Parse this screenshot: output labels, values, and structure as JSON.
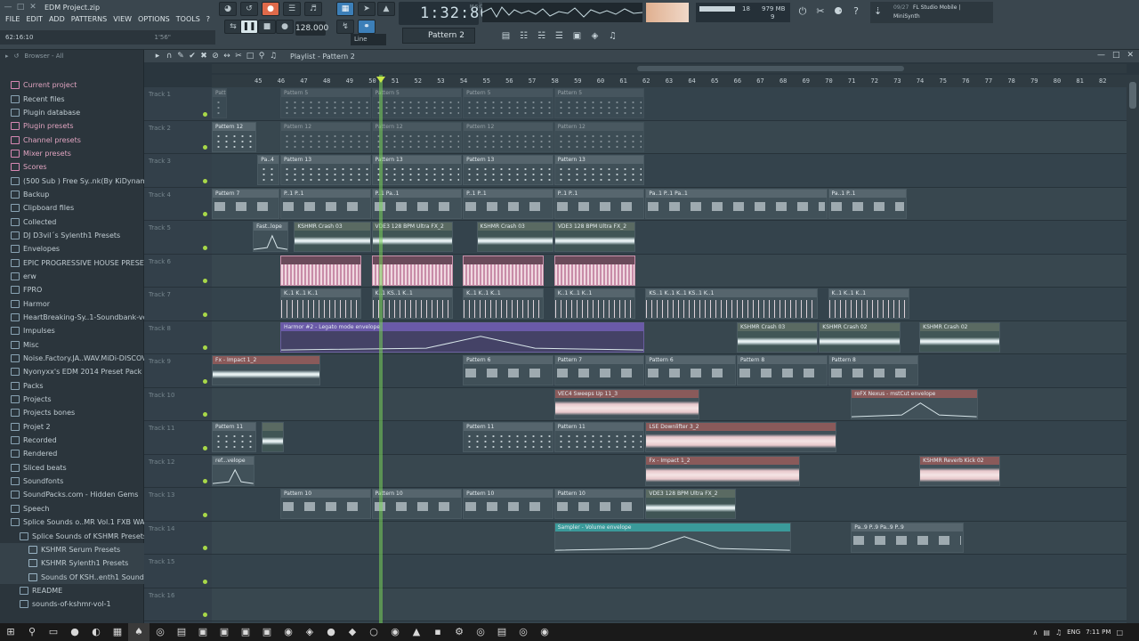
{
  "window": {
    "project_title": "EDM Project.zip"
  },
  "menu": [
    "FILE",
    "EDIT",
    "ADD",
    "PATTERNS",
    "VIEW",
    "OPTIONS",
    "TOOLS",
    "?"
  ],
  "hint": {
    "time": "62:16:10",
    "extra": "1'56\""
  },
  "transport": {
    "tempo": "128.000",
    "song_time": "1:32:86",
    "time_unit": "M:S:CS",
    "pattern": "Pattern 2",
    "snap": "Line"
  },
  "memory": {
    "cpu": "18",
    "ram": "979 MB",
    "poly": "9"
  },
  "news": {
    "date": "09/27",
    "title": "FL Studio Mobile |",
    "subtitle": "MiniSynth"
  },
  "browser": {
    "label": "Browser - All",
    "items": [
      {
        "label": "Current project",
        "style": "pink"
      },
      {
        "label": "Recent files",
        "style": "normal"
      },
      {
        "label": "Plugin database",
        "style": "normal"
      },
      {
        "label": "Plugin presets",
        "style": "pink"
      },
      {
        "label": "Channel presets",
        "style": "pink"
      },
      {
        "label": "Mixer presets",
        "style": "pink"
      },
      {
        "label": "Scores",
        "style": "pink"
      },
      {
        "label": "(500 Sub ) Free Sy..nk(By KiDynamic)",
        "style": "normal"
      },
      {
        "label": "Backup",
        "style": "normal"
      },
      {
        "label": "Clipboard files",
        "style": "normal"
      },
      {
        "label": "Collected",
        "style": "normal"
      },
      {
        "label": "DJ D3vil´s Sylenth1 Presets",
        "style": "normal"
      },
      {
        "label": "Envelopes",
        "style": "normal"
      },
      {
        "label": "EPIC PROGRESSIVE HOUSE PRESETS",
        "style": "normal"
      },
      {
        "label": "erw",
        "style": "normal"
      },
      {
        "label": "FPRO",
        "style": "normal"
      },
      {
        "label": "Harmor",
        "style": "normal"
      },
      {
        "label": "HeartBreaking-Sy..1-Soundbank-vol3",
        "style": "normal"
      },
      {
        "label": "Impulses",
        "style": "normal"
      },
      {
        "label": "Misc",
        "style": "normal"
      },
      {
        "label": "Noise.Factory.JA..WAV.MiDi-DISCOVER",
        "style": "normal"
      },
      {
        "label": "Nyonyxx's EDM 2014 Preset Pack",
        "style": "normal"
      },
      {
        "label": "Packs",
        "style": "normal"
      },
      {
        "label": "Projects",
        "style": "normal"
      },
      {
        "label": "Projects bones",
        "style": "normal"
      },
      {
        "label": "Projet 2",
        "style": "normal"
      },
      {
        "label": "Recorded",
        "style": "normal"
      },
      {
        "label": "Rendered",
        "style": "normal"
      },
      {
        "label": "Sliced beats",
        "style": "normal"
      },
      {
        "label": "Soundfonts",
        "style": "normal"
      },
      {
        "label": "SoundPacks.com - Hidden Gems",
        "style": "normal"
      },
      {
        "label": "Speech",
        "style": "normal"
      },
      {
        "label": "Splice Sounds o..MR Vol.1 FXB WAV",
        "style": "normal"
      },
      {
        "label": "Splice Sounds of KSHMR Presets",
        "style": "lvl2"
      },
      {
        "label": "KSHMR Serum Presets",
        "style": "lvl3"
      },
      {
        "label": "KSHMR Sylenth1 Presets",
        "style": "lvl3"
      },
      {
        "label": "Sounds Of KSH..enth1 Soundset",
        "style": "lvl3"
      },
      {
        "label": "README",
        "style": "lvl2"
      },
      {
        "label": "sounds-of-kshmr-vol-1",
        "style": "lvl2"
      }
    ]
  },
  "playlist": {
    "title": "Playlist - Pattern 2",
    "ruler": [
      "45",
      "46",
      "47",
      "48",
      "49",
      "50",
      "51",
      "52",
      "53",
      "54",
      "55",
      "56",
      "57",
      "58",
      "59",
      "60",
      "61",
      "62",
      "63",
      "64",
      "65",
      "66",
      "67",
      "68",
      "69",
      "70",
      "71",
      "72",
      "73",
      "74",
      "75",
      "76",
      "77",
      "78",
      "79",
      "80",
      "81",
      "82"
    ],
    "tracks": [
      "Track 1",
      "Track 2",
      "Track 3",
      "Track 4",
      "Track 5",
      "Track 6",
      "Track 7",
      "Track 8",
      "Track 9",
      "Track 10",
      "Track 11",
      "Track 12",
      "Track 13",
      "Track 14",
      "Track 15",
      "Track 16"
    ],
    "clips": [
      {
        "track": 0,
        "start": 0.0,
        "len": 0.7,
        "label": "Pattern 4",
        "kind": "notes",
        "dim": true
      },
      {
        "track": 0,
        "start": 3.0,
        "len": 4.0,
        "label": "Pattern 5",
        "kind": "notes",
        "dim": true
      },
      {
        "track": 0,
        "start": 7.0,
        "len": 4.0,
        "label": "Pattern 5",
        "kind": "notes",
        "dim": true
      },
      {
        "track": 0,
        "start": 11.0,
        "len": 4.0,
        "label": "Pattern 5",
        "kind": "notes",
        "dim": true
      },
      {
        "track": 0,
        "start": 15.0,
        "len": 4.0,
        "label": "Pattern 5",
        "kind": "notes",
        "dim": true
      },
      {
        "track": 1,
        "start": 0.0,
        "len": 2.0,
        "label": "Pattern 12",
        "kind": "notes"
      },
      {
        "track": 1,
        "start": 3.0,
        "len": 4.0,
        "label": "Pattern 12",
        "kind": "notes",
        "dim": true
      },
      {
        "track": 1,
        "start": 7.0,
        "len": 4.0,
        "label": "Pattern 12",
        "kind": "notes",
        "dim": true
      },
      {
        "track": 1,
        "start": 11.0,
        "len": 4.0,
        "label": "Pattern 12",
        "kind": "notes",
        "dim": true
      },
      {
        "track": 1,
        "start": 15.0,
        "len": 4.0,
        "label": "Pattern 12",
        "kind": "notes",
        "dim": true
      },
      {
        "track": 2,
        "start": 2.0,
        "len": 1.0,
        "label": "Pa..4",
        "kind": "notes"
      },
      {
        "track": 2,
        "start": 3.0,
        "len": 4.0,
        "label": "Pattern 13",
        "kind": "notes"
      },
      {
        "track": 2,
        "start": 7.0,
        "len": 4.0,
        "label": "Pattern 13",
        "kind": "notes"
      },
      {
        "track": 2,
        "start": 11.0,
        "len": 4.0,
        "label": "Pattern 13",
        "kind": "notes"
      },
      {
        "track": 2,
        "start": 15.0,
        "len": 4.0,
        "label": "Pattern 13",
        "kind": "notes"
      },
      {
        "track": 3,
        "start": 0.0,
        "len": 3.0,
        "label": "Pattern 7",
        "kind": "bars"
      },
      {
        "track": 3,
        "start": 3.0,
        "len": 4.0,
        "label": "P..1 P..1",
        "kind": "bars"
      },
      {
        "track": 3,
        "start": 7.0,
        "len": 4.0,
        "label": "P..1 Pa..1",
        "kind": "bars"
      },
      {
        "track": 3,
        "start": 11.0,
        "len": 4.0,
        "label": "P..1 P..1",
        "kind": "bars"
      },
      {
        "track": 3,
        "start": 15.0,
        "len": 4.0,
        "label": "P..1 P..1",
        "kind": "bars"
      },
      {
        "track": 3,
        "start": 19.0,
        "len": 8.0,
        "label": "Pa..1 P..1 Pa..1",
        "kind": "bars"
      },
      {
        "track": 3,
        "start": 27.0,
        "len": 3.5,
        "label": "Pa..1 P..1",
        "kind": "bars"
      },
      {
        "track": 4,
        "start": 1.8,
        "len": 1.6,
        "label": "Fast..lope",
        "kind": "env",
        "color": "pinkhead"
      },
      {
        "track": 4,
        "start": 3.6,
        "len": 3.4,
        "label": "KSHMR Crash 03",
        "kind": "wave",
        "color": "crash"
      },
      {
        "track": 4,
        "start": 7.0,
        "len": 3.6,
        "label": "VDE3 128 BPM Ultra FX_2",
        "kind": "wave",
        "color": "crash"
      },
      {
        "track": 4,
        "start": 11.6,
        "len": 3.4,
        "label": "KSHMR Crash 03",
        "kind": "wave",
        "color": "crash"
      },
      {
        "track": 4,
        "start": 15.0,
        "len": 3.6,
        "label": "VDE3 128 BPM Ultra FX_2",
        "kind": "wave",
        "color": "crash"
      },
      {
        "track": 5,
        "start": 3.0,
        "len": 3.6,
        "label": "pink",
        "kind": "pinkwave"
      },
      {
        "track": 5,
        "start": 7.0,
        "len": 3.6,
        "label": "pink",
        "kind": "pinkwave"
      },
      {
        "track": 5,
        "start": 11.0,
        "len": 3.6,
        "label": "pink",
        "kind": "pinkwave"
      },
      {
        "track": 5,
        "start": 15.0,
        "len": 3.6,
        "label": "pink",
        "kind": "pinkwave"
      },
      {
        "track": 6,
        "start": 3.0,
        "len": 3.6,
        "label": "K..1 K..1 K..1",
        "kind": "spikes"
      },
      {
        "track": 6,
        "start": 7.0,
        "len": 3.6,
        "label": "K..1 KS..1 K..1",
        "kind": "spikes"
      },
      {
        "track": 6,
        "start": 11.0,
        "len": 3.6,
        "label": "K..1 K..1 K..1",
        "kind": "spikes"
      },
      {
        "track": 6,
        "start": 15.0,
        "len": 3.6,
        "label": "K..1 K..1 K..1",
        "kind": "spikes"
      },
      {
        "track": 6,
        "start": 19.0,
        "len": 7.6,
        "label": "KS..1 K..1 K..1 KS..1 K..1",
        "kind": "spikes"
      },
      {
        "track": 6,
        "start": 27.0,
        "len": 3.6,
        "label": "K..1 K..1 K..1",
        "kind": "spikes"
      },
      {
        "track": 7,
        "start": 3.0,
        "len": 16.0,
        "label": "Harmor #2 - Legato mode envelope",
        "kind": "env",
        "color": "purple"
      },
      {
        "track": 7,
        "start": 23.0,
        "len": 3.6,
        "label": "KSHMR Crash 03",
        "kind": "wave",
        "color": "crash"
      },
      {
        "track": 7,
        "start": 26.6,
        "len": 3.6,
        "label": "KSHMR Crash 02",
        "kind": "wave",
        "color": "crash"
      },
      {
        "track": 7,
        "start": 31.0,
        "len": 3.6,
        "label": "KSHMR Crash 02",
        "kind": "wave",
        "color": "crash"
      },
      {
        "track": 8,
        "start": 0.0,
        "len": 4.8,
        "label": "Fx - Impact 1_2",
        "kind": "wave",
        "color": "orange"
      },
      {
        "track": 8,
        "start": 11.0,
        "len": 4.0,
        "label": "Pattern 6",
        "kind": "bars"
      },
      {
        "track": 8,
        "start": 15.0,
        "len": 4.0,
        "label": "Pattern 7",
        "kind": "bars"
      },
      {
        "track": 8,
        "start": 19.0,
        "len": 4.0,
        "label": "Pattern 6",
        "kind": "bars"
      },
      {
        "track": 8,
        "start": 23.0,
        "len": 4.0,
        "label": "Pattern 8",
        "kind": "bars"
      },
      {
        "track": 8,
        "start": 27.0,
        "len": 4.0,
        "label": "Pattern 8",
        "kind": "bars"
      },
      {
        "track": 9,
        "start": 15.0,
        "len": 6.4,
        "label": "VEC4 Sweeps Up 11_3",
        "kind": "loud",
        "color": "orange"
      },
      {
        "track": 9,
        "start": 28.0,
        "len": 5.6,
        "label": "reFX Nexus - mstCut envelope",
        "kind": "env",
        "color": "orange"
      },
      {
        "track": 10,
        "start": 0.0,
        "len": 2.0,
        "label": "Pattern 11",
        "kind": "notes"
      },
      {
        "track": 10,
        "start": 2.2,
        "len": 1.0,
        "label": "",
        "kind": "wave",
        "color": "crash"
      },
      {
        "track": 10,
        "start": 11.0,
        "len": 4.0,
        "label": "Pattern 11",
        "kind": "notes"
      },
      {
        "track": 10,
        "start": 15.0,
        "len": 4.0,
        "label": "Pattern 11",
        "kind": "notes"
      },
      {
        "track": 10,
        "start": 19.0,
        "len": 8.4,
        "label": "LSE Downlifter 3_2",
        "kind": "loud",
        "color": "orange"
      },
      {
        "track": 11,
        "start": 0.0,
        "len": 1.9,
        "label": "ref...velope",
        "kind": "env",
        "color": "pinkhead"
      },
      {
        "track": 11,
        "start": 19.0,
        "len": 6.8,
        "label": "Fx - Impact 1_2",
        "kind": "loud",
        "color": "orange"
      },
      {
        "track": 11,
        "start": 31.0,
        "len": 3.6,
        "label": "KSHMR Reverb Kick 02",
        "kind": "loud",
        "color": "orange"
      },
      {
        "track": 12,
        "start": 3.0,
        "len": 4.0,
        "label": "Pattern 10",
        "kind": "bars"
      },
      {
        "track": 12,
        "start": 7.0,
        "len": 4.0,
        "label": "Pattern 10",
        "kind": "bars"
      },
      {
        "track": 12,
        "start": 11.0,
        "len": 4.0,
        "label": "Pattern 10",
        "kind": "bars"
      },
      {
        "track": 12,
        "start": 15.0,
        "len": 4.0,
        "label": "Pattern 10",
        "kind": "bars"
      },
      {
        "track": 12,
        "start": 19.0,
        "len": 4.0,
        "label": "VDE3 128 BPM Ultra FX_2",
        "kind": "wave",
        "color": "crash"
      },
      {
        "track": 13,
        "start": 15.0,
        "len": 10.4,
        "label": "Sampler - Volume envelope",
        "kind": "env",
        "color": "teal"
      },
      {
        "track": 13,
        "start": 28.0,
        "len": 5.0,
        "label": "Pa..9 P..9 Pa..9 P..9",
        "kind": "bars"
      }
    ]
  },
  "taskbar": {
    "lang": "ENG",
    "time": "7:11 PM"
  }
}
